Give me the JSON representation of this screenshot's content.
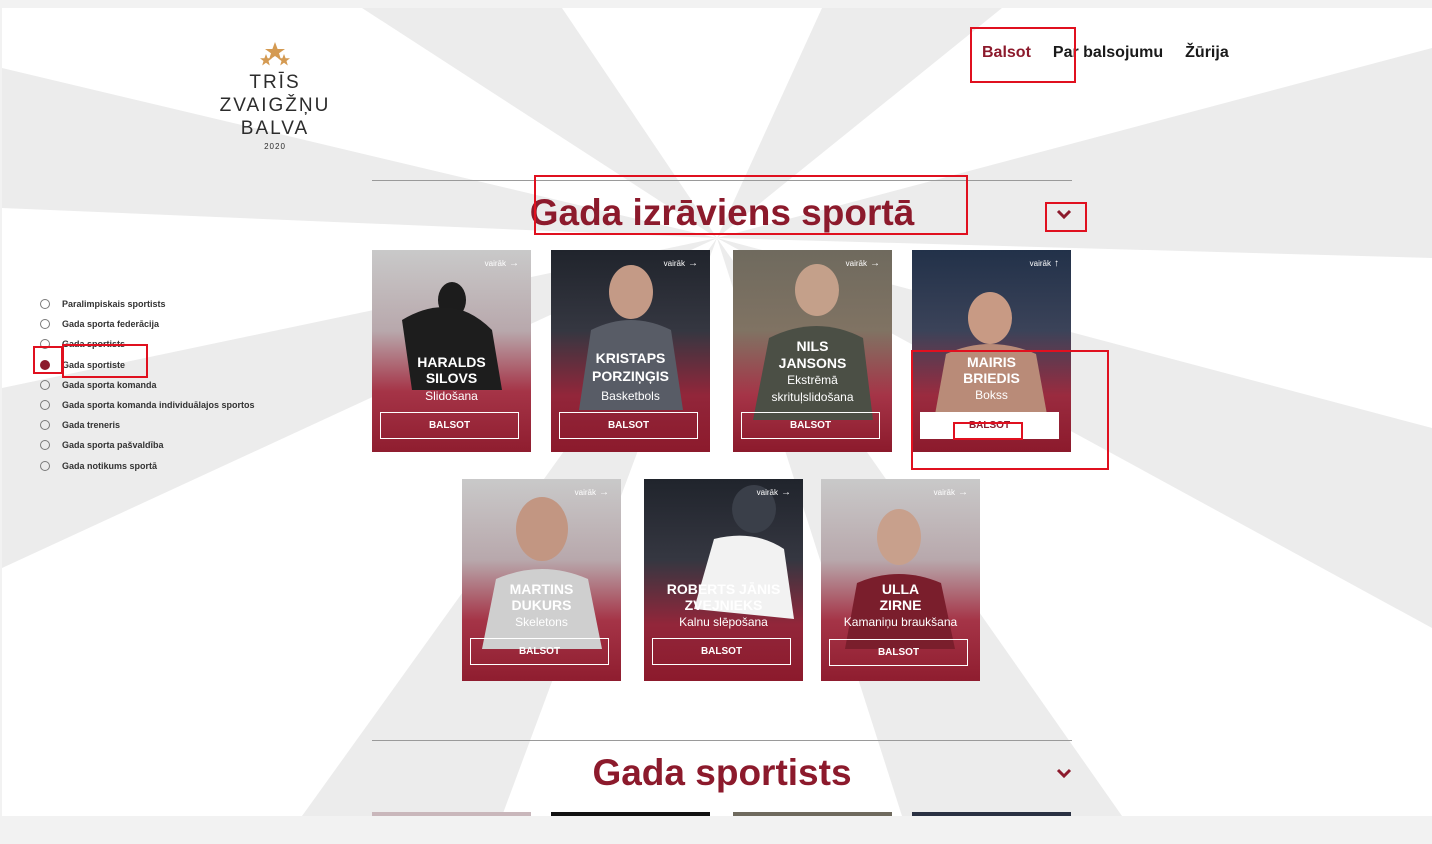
{
  "logo": {
    "line1": "TRĪS",
    "line2": "ZVAIGŽŅU",
    "line3": "BALVA",
    "year": "2020"
  },
  "nav": {
    "vote": "Balsot",
    "about": "Par balsojumu",
    "jury": "Žūrija"
  },
  "sidebar": {
    "items": [
      {
        "label": "Paralimpiskais sportists",
        "selected": false
      },
      {
        "label": "Gada sporta federācija",
        "selected": false
      },
      {
        "label": "Gada sportists",
        "selected": false
      },
      {
        "label": "Gada sportiste",
        "selected": true
      },
      {
        "label": "Gada sporta komanda",
        "selected": false
      },
      {
        "label": "Gada sporta komanda individuālajos sportos",
        "selected": false
      },
      {
        "label": "Gada treneris",
        "selected": false
      },
      {
        "label": "Gada sporta pašvaldība",
        "selected": false
      },
      {
        "label": "Gada notikums sportā",
        "selected": false
      }
    ]
  },
  "section1": {
    "title": "Gada izrāviens sportā",
    "cards": [
      {
        "name1": "HARALDS",
        "name2": "SILOVS",
        "sport1": "Slidošana",
        "sport2": "",
        "more": "vairāk",
        "button": "BALSOT"
      },
      {
        "name1": "KRISTAPS",
        "name2": "PORZIŅĢIS",
        "sport1": "Basketbols",
        "sport2": "",
        "more": "vairāk",
        "button": "BALSOT"
      },
      {
        "name1": "NILS",
        "name2": "JANSONS",
        "sport1": "Ekstrēmā",
        "sport2": "skrituļslidošana",
        "more": "vairāk",
        "button": "BALSOT"
      },
      {
        "name1": "MAIRIS",
        "name2": "BRIEDIS",
        "sport1": "Bokss",
        "sport2": "",
        "more": "vairāk",
        "button": "BALSOT"
      },
      {
        "name1": "MARTINS",
        "name2": "DUKURS",
        "sport1": "Skeletons",
        "sport2": "",
        "more": "vairāk",
        "button": "BALSOT"
      },
      {
        "name1": "ROBERTS JĀNIS",
        "name2": "ZVEJNIEKS",
        "sport1": "Kalnu slēpošana",
        "sport2": "",
        "more": "vairāk",
        "button": "BALSOT"
      },
      {
        "name1": "ULLA",
        "name2": "ZIRNE",
        "sport1": "Kamaniņu braukšana",
        "sport2": "",
        "more": "vairāk",
        "button": "BALSOT"
      }
    ]
  },
  "section2": {
    "title": "Gada sportists"
  },
  "colors": {
    "accent": "#8c1a2c",
    "highlight": "#e0101f"
  },
  "icons": {
    "star": "star-icon",
    "chevron": "chevron-down-icon",
    "arrow": "arrow-right-icon"
  }
}
